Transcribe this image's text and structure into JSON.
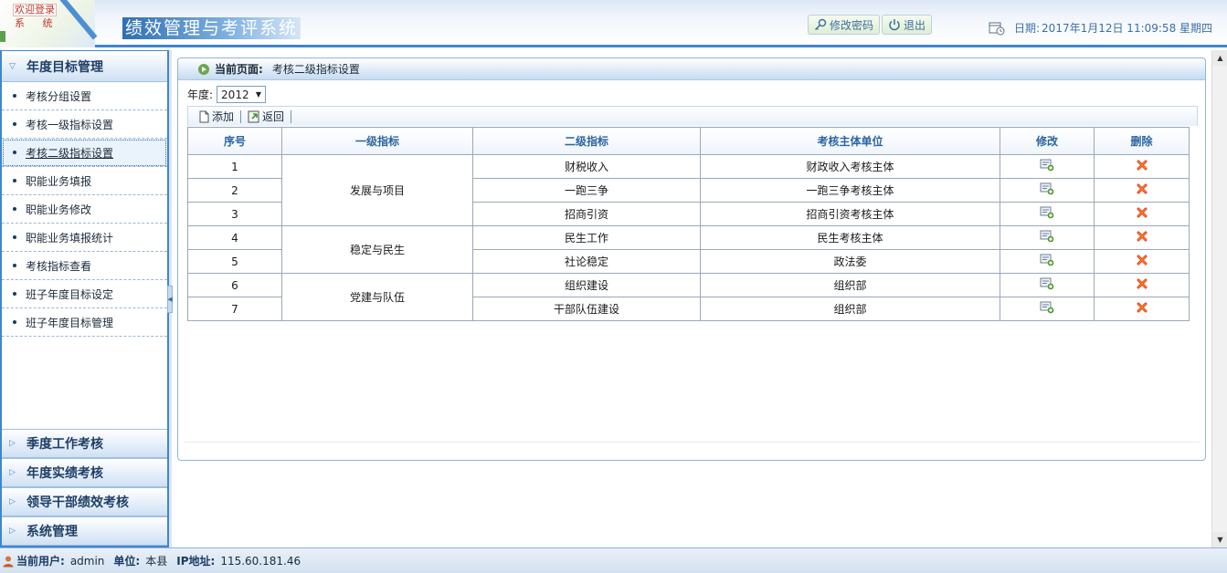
{
  "header": {
    "logo_line1": "欢迎登录",
    "logo_line2": "系 统",
    "system_title": "绩效管理与考评系统",
    "change_password_label": "修改密码",
    "logout_label": "退出",
    "date_label": "日期:",
    "date_value": "2017年1月12日 11:09:58 星期四"
  },
  "sidebar": {
    "open_section": "年度目标管理",
    "items": [
      {
        "label": "考核分组设置"
      },
      {
        "label": "考核一级指标设置"
      },
      {
        "label": "考核二级指标设置",
        "active": true
      },
      {
        "label": "职能业务填报"
      },
      {
        "label": "职能业务修改"
      },
      {
        "label": "职能业务填报统计"
      },
      {
        "label": "考核指标查看"
      },
      {
        "label": "班子年度目标设定"
      },
      {
        "label": "班子年度目标管理"
      }
    ],
    "collapsed_sections": [
      "季度工作考核",
      "年度实绩考核",
      "领导干部绩效考核",
      "系统管理"
    ]
  },
  "main": {
    "current_page_label": "当前页面:",
    "current_page": "考核二级指标设置",
    "year_label": "年度:",
    "year_value": "2012",
    "toolbar": {
      "add_label": "添加",
      "back_label": "返回"
    },
    "table": {
      "headers": [
        "序号",
        "一级指标",
        "二级指标",
        "考核主体单位",
        "修改",
        "删除"
      ],
      "groups": [
        {
          "level1": "发展与项目",
          "rows": [
            {
              "no": "1",
              "level2": "财税收入",
              "unit": "财政收入考核主体"
            },
            {
              "no": "2",
              "level2": "一跑三争",
              "unit": "一跑三争考核主体"
            },
            {
              "no": "3",
              "level2": "招商引资",
              "unit": "招商引资考核主体"
            }
          ]
        },
        {
          "level1": "稳定与民生",
          "rows": [
            {
              "no": "4",
              "level2": "民生工作",
              "unit": "民生考核主体"
            },
            {
              "no": "5",
              "level2": "社论稳定",
              "unit": "政法委"
            }
          ]
        },
        {
          "level1": "党建与队伍",
          "rows": [
            {
              "no": "6",
              "level2": "组织建设",
              "unit": "组织部"
            },
            {
              "no": "7",
              "level2": "干部队伍建设",
              "unit": "组织部"
            }
          ]
        }
      ]
    }
  },
  "footer": {
    "user_label": "当前用户:",
    "user_value": "admin",
    "unit_label": "单位:",
    "unit_value": "本县",
    "ip_label": "IP地址:",
    "ip_value": "115.60.181.46"
  },
  "colors": {
    "accent": "#3f86cf",
    "header_text": "#2b65a3",
    "delete": "#e8401c",
    "edit": "#4c9a2a"
  }
}
